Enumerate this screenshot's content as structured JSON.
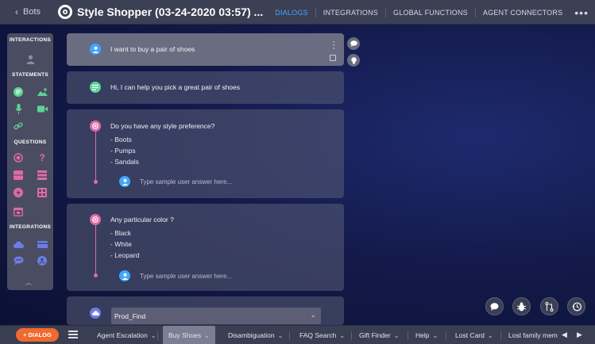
{
  "topbar": {
    "back_label": "Bots",
    "title": "Style Shopper (03-24-2020 03:57) ...",
    "tabs": [
      "DIALOGS",
      "INTEGRATIONS",
      "GLOBAL FUNCTIONS",
      "AGENT CONNECTORS"
    ],
    "active_tab": "DIALOGS",
    "more": "•••"
  },
  "palette": {
    "sections": [
      "INTERACTIONS",
      "STATEMENTS",
      "QUESTIONS",
      "INTEGRATIONS"
    ],
    "collapse": "︿"
  },
  "cards": {
    "user_message": "I want to buy a pair of shoes",
    "bot_statement": "Hi, I can help you pick a great pair of shoes",
    "q1": {
      "prompt": "Do you have any style preference?",
      "options": [
        "- Boots",
        "- Pumps",
        "- Sandals"
      ],
      "answer_placeholder": "Type sample user answer here..."
    },
    "q2": {
      "prompt": "Any particular color ?",
      "options": [
        "- Black",
        "- White",
        "- Leopard"
      ],
      "answer_placeholder": "Type sample user answer here..."
    },
    "integration_select": "Prod_Find"
  },
  "bottombar": {
    "dialog_button": "+ DIALOG",
    "tabs": [
      "Agent Escalation",
      "Buy Shoes",
      "Disambiguation",
      "FAQ Search",
      "Gift Finder",
      "Help",
      "Lost Card",
      "Lost family mem"
    ],
    "active_tab": "Buy Shoes"
  },
  "colors": {
    "accent_blue": "#3fa7ff",
    "dialog_orange": "#ef6a2e",
    "statement_green": "#5fd39a",
    "question_pink": "#e06aa8",
    "integration_blue": "#6b7dea"
  }
}
